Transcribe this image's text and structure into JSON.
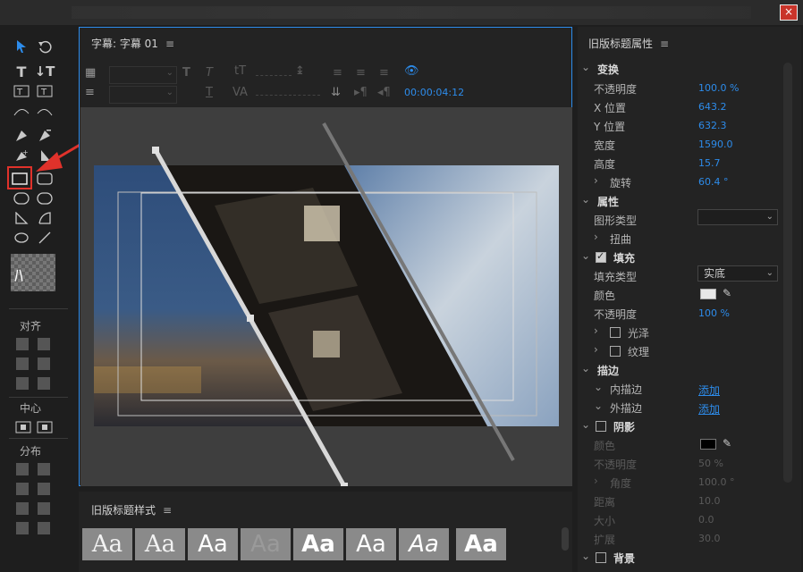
{
  "window": {
    "close_label": "×"
  },
  "title_panel": {
    "tab_label": "字幕: 字幕 01",
    "timecode": "00:00:04:12"
  },
  "tools": {
    "section_align": "对齐",
    "section_center": "中心",
    "section_distribute": "分布"
  },
  "style_panel": {
    "title": "旧版标题样式",
    "swatches": [
      "Aa",
      "Aa",
      "Aa",
      "Aa",
      "Aa",
      "Aa",
      "Aa",
      "Aa"
    ]
  },
  "props": {
    "title": "旧版标题属性",
    "transform": {
      "header": "变换",
      "opacity_label": "不透明度",
      "opacity": "100.0 %",
      "x_label": "X 位置",
      "x": "643.2",
      "y_label": "Y 位置",
      "y": "632.3",
      "width_label": "宽度",
      "width": "1590.0",
      "height_label": "高度",
      "height": "15.7",
      "rotation_label": "旋转",
      "rotation": "60.4 °"
    },
    "attributes": {
      "header": "属性",
      "shape_type_label": "图形类型",
      "shape_type": "",
      "distort_label": "扭曲"
    },
    "fill": {
      "header": "填充",
      "fill_type_label": "填充类型",
      "fill_type": "实底",
      "color_label": "颜色",
      "color": "#e8e8e8",
      "opacity_label": "不透明度",
      "opacity": "100 %",
      "sheen_label": "光泽",
      "texture_label": "纹理"
    },
    "stroke": {
      "header": "描边",
      "inner_label": "内描边",
      "inner_action": "添加",
      "outer_label": "外描边",
      "outer_action": "添加"
    },
    "shadow": {
      "header": "阴影",
      "color_label": "颜色",
      "color": "#000000",
      "opacity_label": "不透明度",
      "opacity": "50 %",
      "angle_label": "角度",
      "angle": "100.0 °",
      "distance_label": "距离",
      "distance": "10.0",
      "size_label": "大小",
      "size": "0.0",
      "spread_label": "扩展",
      "spread": "30.0"
    },
    "background": {
      "header": "背景"
    }
  },
  "colors": {
    "accent": "#2d8ceb",
    "highlight": "#e0322b"
  }
}
